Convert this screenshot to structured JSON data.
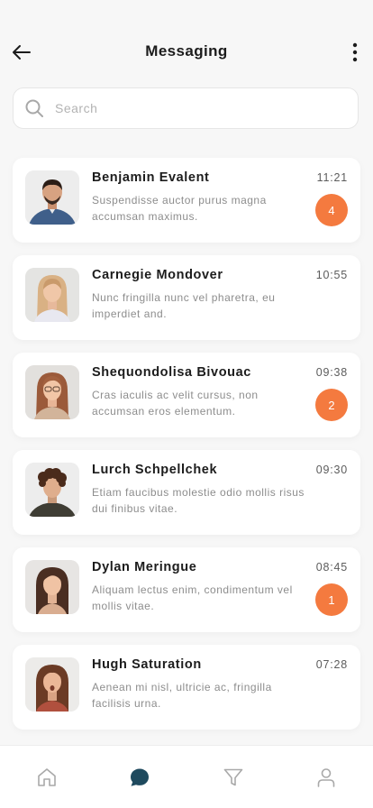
{
  "header": {
    "title": "Messaging"
  },
  "search": {
    "placeholder": "Search"
  },
  "conversations": [
    {
      "name": "Benjamin Evalent",
      "preview": "Suspendisse auctor purus  magna accumsan maximus.",
      "time": "11:21",
      "unread": "4"
    },
    {
      "name": "Carnegie Mondover",
      "preview": "Nunc fringilla nunc vel pharetra, eu imperdiet and.",
      "time": "10:55",
      "unread": ""
    },
    {
      "name": "Shequondolisa Bivouac",
      "preview": "Cras iaculis ac velit cursus, non accumsan eros elementum.",
      "time": "09:38",
      "unread": "2"
    },
    {
      "name": "Lurch Schpellchek",
      "preview": "Etiam faucibus molestie odio mollis risus dui finibus vitae.",
      "time": "09:30",
      "unread": ""
    },
    {
      "name": "Dylan Meringue",
      "preview": "Aliquam lectus enim, condimentum vel mollis vitae.",
      "time": "08:45",
      "unread": "1"
    },
    {
      "name": "Hugh Saturation",
      "preview": "Aenean mi nisl, ultricie ac, fringilla facilisis urna.",
      "time": "07:28",
      "unread": ""
    }
  ],
  "bottom_nav": {
    "items": [
      "home-icon",
      "chat-icon",
      "filter-icon",
      "profile-icon"
    ],
    "active": "chat-icon"
  },
  "colors": {
    "accent": "#f47a3f",
    "active_nav": "#1f4a5e",
    "inactive_nav": "#a9a9a9"
  }
}
